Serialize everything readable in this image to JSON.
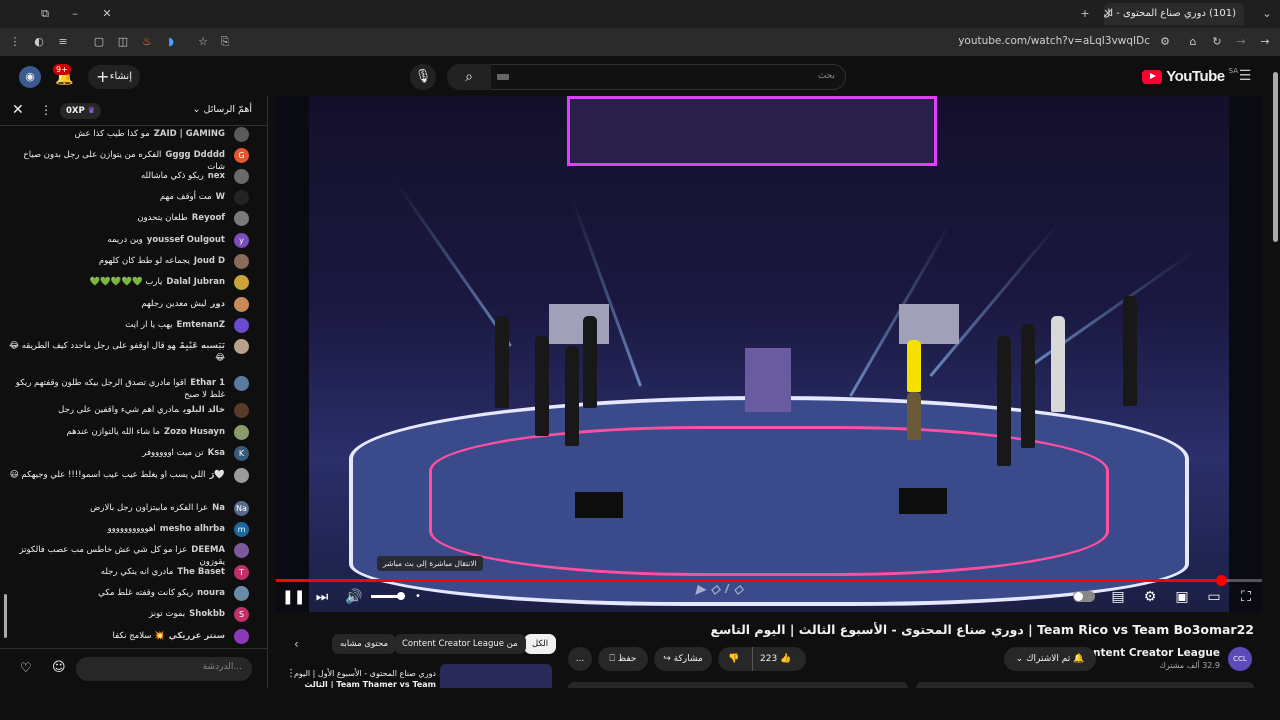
{
  "browser": {
    "tab_title": "(101) دوري صناع المحتوى - ال",
    "url": "youtube.com/watch?v=aLqI3vwqIDc"
  },
  "header": {
    "logo_text": "YouTube",
    "region": "SA",
    "search_placeholder": "بحث",
    "create_label": "إنشاء",
    "notif_count": "9+"
  },
  "chat": {
    "header_title": "أهمّ الرسائل",
    "xp_label": "0XP",
    "input_placeholder": "الدردشة...",
    "messages": [
      {
        "author": "ZAID | GAMING",
        "text": "مو كذا طيب كذا عش",
        "initial": "",
        "color": "#5a5a5a"
      },
      {
        "author": "Gggg Ddddd",
        "text": "الفكره من يتوازن على رجل بدون صياح شات",
        "initial": "G",
        "color": "#e4572e"
      },
      {
        "author": "nex",
        "text": "ريكو ذكي ماشالله",
        "initial": "",
        "color": "#6a6a6a"
      },
      {
        "author": "W",
        "text": "مت أوقف مهم",
        "initial": "",
        "color": "#222222"
      },
      {
        "author": "Reyoof",
        "text": "طلعان يتحدون",
        "initial": "",
        "color": "#7a7a7a"
      },
      {
        "author": "youssef Oulgout",
        "text": "وين دريمه",
        "initial": "y",
        "color": "#7c4dbb"
      },
      {
        "author": "Joud D",
        "text": "يجماعه لو طط كان كلهوم",
        "initial": "",
        "color": "#8a6a5a"
      },
      {
        "author": "Dalal Jubran",
        "text": "يارب 💚💚💚💚💚",
        "initial": "",
        "color": "#c9a23a"
      },
      {
        "author": "دور",
        "text": "ليش معدين رجلهم",
        "initial": "",
        "color": "#c98a5a"
      },
      {
        "author": "EmtenanZ",
        "text": "يهب يا ار ايت",
        "initial": "",
        "color": "#6a4acd"
      },
      {
        "author": "بَيَسبه عَبْيِمْ",
        "text": "هو قال اوقفو على رجل ماحدد كيف الطريقه 😂😂",
        "initial": "",
        "color": "#b8a08a"
      },
      {
        "author": "Ethar 1",
        "text": "اقوا مادري تصدق الرجل بيكه طلون وقفتهم ريكو غلط لا صبح",
        "initial": "",
        "color": "#5a7aa0"
      },
      {
        "author": "خالد البلوي",
        "text": "مادري اهم شيء واقفين على رجل",
        "initial": "",
        "color": "#5a3a2a"
      },
      {
        "author": "Zozo Husayn",
        "text": "ما شاء الله يالتوازن عندهم",
        "initial": "",
        "color": "#8a9a6a"
      },
      {
        "author": "Ksa",
        "text": "تن ميت اوووووفر",
        "initial": "K",
        "color": "#3a5a7a"
      },
      {
        "author": "🤍رَ",
        "text": "اللي يسب او يغلط عيب عيب اسمو!!!! علي وجيهكم 😃",
        "initial": "",
        "color": "#9a9a9a"
      },
      {
        "author": "Na",
        "text": "عرا الفكره مابيتزاون رجل بالارض",
        "initial": "Na",
        "color": "#5a6a8a"
      },
      {
        "author": "mesho alhrba",
        "text": "اهوووووووووو",
        "initial": "m",
        "color": "#1a6aa0"
      },
      {
        "author": "DEEMA",
        "text": "عزا مو كل شي عش خاطس مب عصب فالكوتز يقوزون",
        "initial": "",
        "color": "#7a5a9a"
      },
      {
        "author": "The Baset",
        "text": "مادري انه يتكي رجله",
        "initial": "T",
        "color": "#c0306a"
      },
      {
        "author": "noura",
        "text": "ريكو كانت وقفته غلط مكي",
        "initial": "",
        "color": "#6a8aaa"
      },
      {
        "author": "Shokbb",
        "text": "بموت تونز",
        "initial": "S",
        "color": "#c0306a"
      },
      {
        "author": "سنتر عرريكي",
        "text": "💥 سلامج نكفا",
        "initial": "",
        "color": "#8a3ab8"
      }
    ]
  },
  "player": {
    "tooltip": "الانتقال مباشرة إلى بث مباشر",
    "live_label": "•",
    "progress": 0.958,
    "volume": 0.85
  },
  "video": {
    "title": "Team Rico vs Team Bo3omar22 | دوري صناع المحتوى - الأسبوع الثالث | اليوم التاسع",
    "channel_name": "Content Creator League",
    "subscribers": "32.9 ألف مشترك",
    "subscribed_label": "تم الاشتراك",
    "likes": "223",
    "share_label": "مشاركة",
    "save_label": "حفظ",
    "more_label": "..."
  },
  "chips": {
    "all": "الكل",
    "from_channel": "من Content Creator League",
    "similar": "محتوى مشابه"
  },
  "related": {
    "first_title_line1": "دوري صناع المحتوى - الأسبوع الأول | اليوم",
    "first_title_line2": "Team Thamer vs Team | الثالث"
  }
}
